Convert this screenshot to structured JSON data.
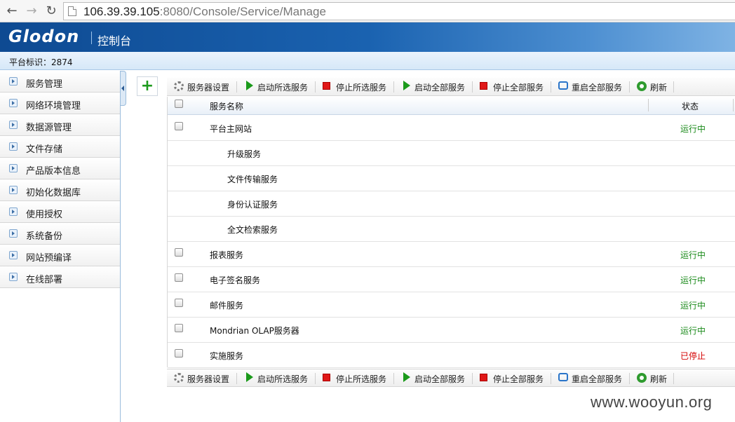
{
  "browser": {
    "url_host": "106.39.39.105",
    "url_rest": ":8080/Console/Service/Manage"
  },
  "header": {
    "logo": "Glodon",
    "title": "控制台"
  },
  "platform": {
    "label": "平台标识：2874"
  },
  "sidebar": {
    "items": [
      {
        "label": "服务管理"
      },
      {
        "label": "网络环境管理"
      },
      {
        "label": "数据源管理"
      },
      {
        "label": "文件存储"
      },
      {
        "label": "产品版本信息"
      },
      {
        "label": "初始化数据库"
      },
      {
        "label": "使用授权"
      },
      {
        "label": "系统备份"
      },
      {
        "label": "网站预编译"
      },
      {
        "label": "在线部署"
      }
    ]
  },
  "add_button": "+",
  "toolbar": {
    "server_settings": "服务器设置",
    "start_selected": "启动所选服务",
    "stop_selected": "停止所选服务",
    "start_all": "启动全部服务",
    "stop_all": "停止全部服务",
    "restart_all": "重启全部服务",
    "refresh": "刷新"
  },
  "table": {
    "col_name": "服务名称",
    "col_status": "状态",
    "rows": [
      {
        "name": "平台主网站",
        "status": "运行中",
        "state": "running",
        "checkbox": true,
        "indent": false
      },
      {
        "name": "升级服务",
        "status": "",
        "state": "",
        "checkbox": false,
        "indent": true
      },
      {
        "name": "文件传输服务",
        "status": "",
        "state": "",
        "checkbox": false,
        "indent": true
      },
      {
        "name": "身份认证服务",
        "status": "",
        "state": "",
        "checkbox": false,
        "indent": true
      },
      {
        "name": "全文检索服务",
        "status": "",
        "state": "",
        "checkbox": false,
        "indent": true
      },
      {
        "name": "报表服务",
        "status": "运行中",
        "state": "running",
        "checkbox": true,
        "indent": false
      },
      {
        "name": "电子签名服务",
        "status": "运行中",
        "state": "running",
        "checkbox": true,
        "indent": false
      },
      {
        "name": "邮件服务",
        "status": "运行中",
        "state": "running",
        "checkbox": true,
        "indent": false
      },
      {
        "name": "Mondrian OLAP服务器",
        "status": "运行中",
        "state": "running",
        "checkbox": true,
        "indent": false
      },
      {
        "name": "实施服务",
        "status": "已停止",
        "state": "stopped",
        "checkbox": true,
        "indent": false
      }
    ]
  },
  "watermark": "www.wooyun.org"
}
